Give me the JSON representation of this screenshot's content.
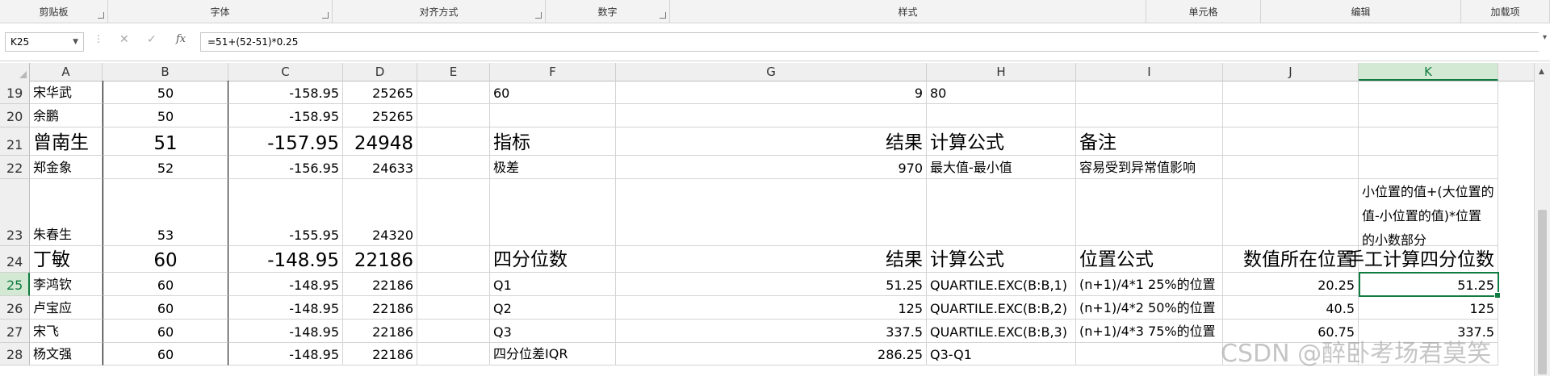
{
  "ribbon": {
    "groups": [
      "剪贴板",
      "字体",
      "对齐方式",
      "数字",
      "样式",
      "单元格",
      "编辑",
      "加载项"
    ]
  },
  "formula_bar": {
    "name_box": "K25",
    "formula": "=51+(52-51)*0.25",
    "fx_label": "fx"
  },
  "columns": [
    "A",
    "B",
    "C",
    "D",
    "E",
    "F",
    "G",
    "H",
    "I",
    "J",
    "K"
  ],
  "selected_column": "K",
  "rows": [
    {
      "num": "19",
      "A": "宋华武",
      "B": "50",
      "C": "-158.95",
      "D": "25265",
      "F": "60",
      "G": "9",
      "H": "80"
    },
    {
      "num": "20",
      "A": "余鹏",
      "B": "50",
      "C": "-158.95",
      "D": "25265"
    },
    {
      "num": "21",
      "A": "曾南生",
      "B": "51",
      "C": "-157.95",
      "D": "24948",
      "F": "指标",
      "G": "结果",
      "H": "计算公式",
      "I": "备注"
    },
    {
      "num": "22",
      "A": "郑金象",
      "B": "52",
      "C": "-156.95",
      "D": "24633",
      "F": "极差",
      "G": "970",
      "H": "最大值-最小值",
      "I": "容易受到异常值影响"
    },
    {
      "num": "23",
      "A": "朱春生",
      "B": "53",
      "C": "-155.95",
      "D": "24320",
      "K": "小位置的值+(大位置的值-小位置的值)*位置的小数部分"
    },
    {
      "num": "24",
      "A": "丁敏",
      "B": "60",
      "C": "-148.95",
      "D": "22186",
      "F": "四分位数",
      "G": "结果",
      "H": "计算公式",
      "I": "位置公式",
      "J": "数值所在位置",
      "K": "手工计算四分位数"
    },
    {
      "num": "25",
      "A": "李鸿钦",
      "B": "60",
      "C": "-148.95",
      "D": "22186",
      "F": "Q1",
      "G": "51.25",
      "H": "QUARTILE.EXC(B:B,1)",
      "I": "(n+1)/4*1  25%的位置",
      "J": "20.25",
      "K": "51.25"
    },
    {
      "num": "26",
      "A": "卢宝应",
      "B": "60",
      "C": "-148.95",
      "D": "22186",
      "F": "Q2",
      "G": "125",
      "H": "QUARTILE.EXC(B:B,2)",
      "I": "(n+1)/4*2  50%的位置",
      "J": "40.5",
      "K": "125"
    },
    {
      "num": "27",
      "A": "宋飞",
      "B": "60",
      "C": "-148.95",
      "D": "22186",
      "F": "Q3",
      "G": "337.5",
      "H": "QUARTILE.EXC(B:B,3)",
      "I": "(n+1)/4*3  75%的位置",
      "J": "60.75",
      "K": "337.5"
    },
    {
      "num": "28",
      "A": "杨文强",
      "B": "60",
      "C": "-148.95",
      "D": "22186",
      "F": "四分位差IQR",
      "G": "286.25",
      "H": "Q3-Q1"
    }
  ],
  "watermark": "CSDN @醉卧考场君莫笑",
  "colors": {
    "accent": "#107c41",
    "selected_header": "#d3e9d3",
    "grid": "#d4d4d4"
  }
}
